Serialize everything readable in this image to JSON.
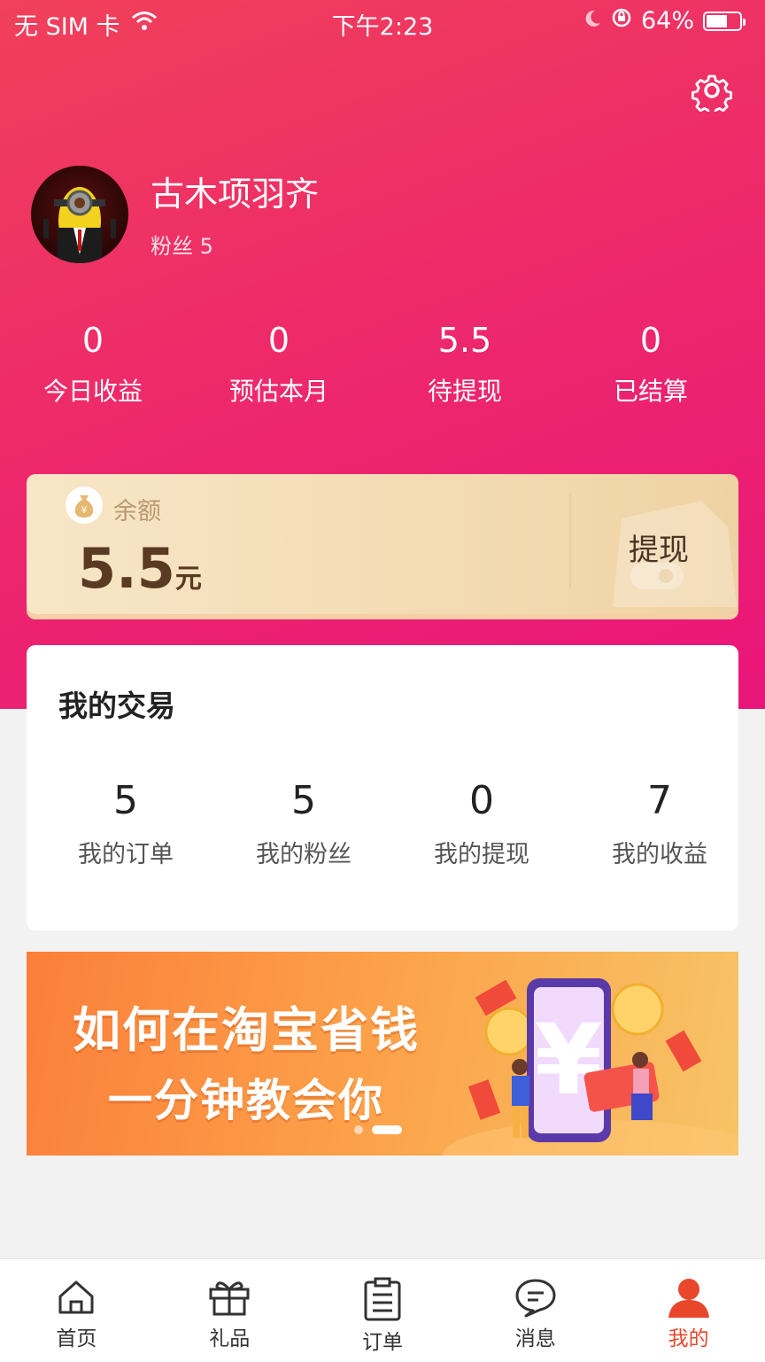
{
  "status_bar": {
    "carrier": "无 SIM 卡",
    "time": "下午2:23",
    "battery": "64%",
    "battery_level": 0.64
  },
  "profile": {
    "name": "古木项羽齐",
    "fans": "粉丝 5"
  },
  "stats": [
    {
      "value": "0",
      "label": "今日收益"
    },
    {
      "value": "0",
      "label": "预估本月"
    },
    {
      "value": "5.5",
      "label": "待提现"
    },
    {
      "value": "0",
      "label": "已结算"
    }
  ],
  "balance": {
    "label": "余额",
    "amount": "5.5",
    "unit": "元",
    "withdraw_label": "提现"
  },
  "transactions": {
    "title": "我的交易",
    "items": [
      {
        "value": "5",
        "label": "我的订单"
      },
      {
        "value": "5",
        "label": "我的粉丝"
      },
      {
        "value": "0",
        "label": "我的提现"
      },
      {
        "value": "7",
        "label": "我的收益"
      }
    ]
  },
  "banner": {
    "line1": "如何在淘宝省钱",
    "line2": "一分钟教会你",
    "active_slide": 2,
    "slide_count": 2
  },
  "tabbar": {
    "items": [
      {
        "label": "首页",
        "icon": "home-icon"
      },
      {
        "label": "礼品",
        "icon": "gift-icon"
      },
      {
        "label": "订单",
        "icon": "clipboard-icon"
      },
      {
        "label": "消息",
        "icon": "chat-bubble-icon"
      },
      {
        "label": "我的",
        "icon": "user-icon"
      }
    ],
    "active_index": 4
  },
  "colors": {
    "hero_start": "#f0405a",
    "hero_end": "#e9157a",
    "active_tab": "#e8472c",
    "balance_text": "#5a3a22"
  }
}
